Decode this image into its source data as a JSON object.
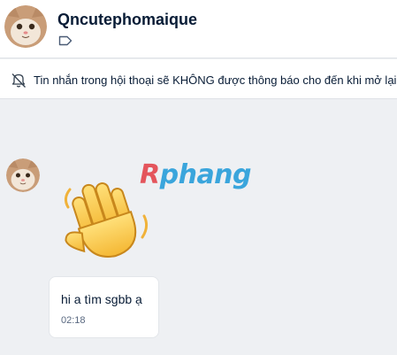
{
  "header": {
    "contact_name": "Qncutephomaique"
  },
  "notice": {
    "text": "Tin nhắn trong hội thoại sẽ KHÔNG được thông báo cho đến khi mở lại"
  },
  "watermark": {
    "first_letter": "R",
    "rest": "phang"
  },
  "messages": [
    {
      "text": "hi a tìm sgbb ạ",
      "time": "02:18"
    }
  ],
  "icons": {
    "tag": "tag-outline-icon",
    "notification": "bell-off-icon",
    "sticker": "waving-hand-sticker"
  }
}
